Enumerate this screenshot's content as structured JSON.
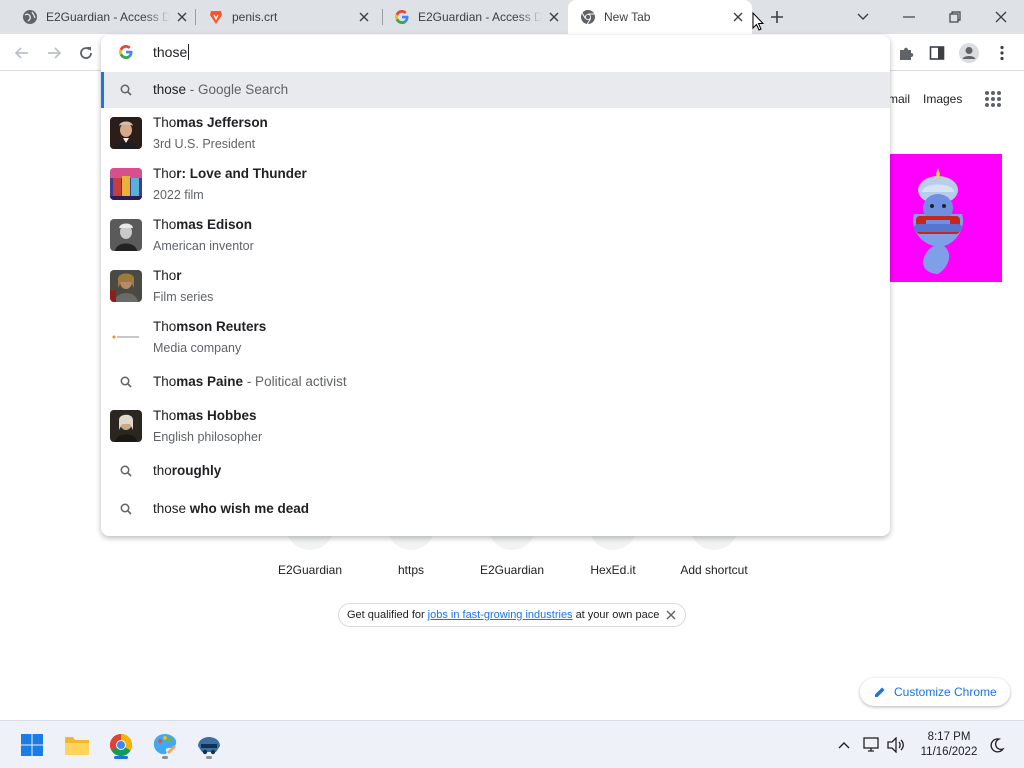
{
  "tabs": [
    {
      "title": "E2Guardian - Access De",
      "icon": "globe-icon"
    },
    {
      "title": "penis.crt",
      "icon": "brave-icon"
    },
    {
      "title": "E2Guardian - Access De",
      "icon": "google-icon"
    },
    {
      "title": "New Tab",
      "icon": "chrome-icon"
    }
  ],
  "omnibox": {
    "query": "those",
    "suggestions": [
      {
        "kind": "search",
        "prefix": "those",
        "bold": "",
        "desc": " - Google Search",
        "selected": true
      },
      {
        "kind": "entity",
        "prefix": "Tho",
        "bold": "mas Jefferson",
        "sub": "3rd U.S. President",
        "thumb": "jefferson-thumb"
      },
      {
        "kind": "entity",
        "prefix": "Tho",
        "bold": "r: Love and Thunder",
        "sub": "2022 film",
        "thumb": "thor-film-thumb"
      },
      {
        "kind": "entity",
        "prefix": "Tho",
        "bold": "mas Edison",
        "sub": "American inventor",
        "thumb": "edison-thumb"
      },
      {
        "kind": "entity",
        "prefix": "Tho",
        "bold": "r",
        "sub": "Film series",
        "thumb": "thor-series-thumb"
      },
      {
        "kind": "entity",
        "prefix": "Tho",
        "bold": "mson Reuters",
        "sub": "Media company",
        "thumb": "reuters-thumb"
      },
      {
        "kind": "search",
        "prefix": "Tho",
        "bold": "mas Paine",
        "desc": " - Political activist"
      },
      {
        "kind": "entity",
        "prefix": "Tho",
        "bold": "mas Hobbes",
        "sub": "English philosopher",
        "thumb": "hobbes-thumb"
      },
      {
        "kind": "search",
        "prefix": "tho",
        "bold": "roughly",
        "desc": ""
      },
      {
        "kind": "search",
        "prefix": "those",
        "bold": " who wish me dead",
        "desc": ""
      }
    ]
  },
  "ntp": {
    "gmail": "mail",
    "images": "Images",
    "shortcuts": [
      "E2Guardian",
      "https",
      "E2Guardian",
      "HexEd.it",
      "Add shortcut"
    ],
    "promo_before": "Get qualified for",
    "promo_link": "jobs in fast-growing industries",
    "promo_after": "at your own pace",
    "customize": "Customize Chrome"
  },
  "taskbar": {
    "time": "8:17 PM",
    "date": "11/16/2022"
  },
  "colors": {
    "accent": "#1a73e8",
    "doodle_bg": "#ff00ff"
  }
}
